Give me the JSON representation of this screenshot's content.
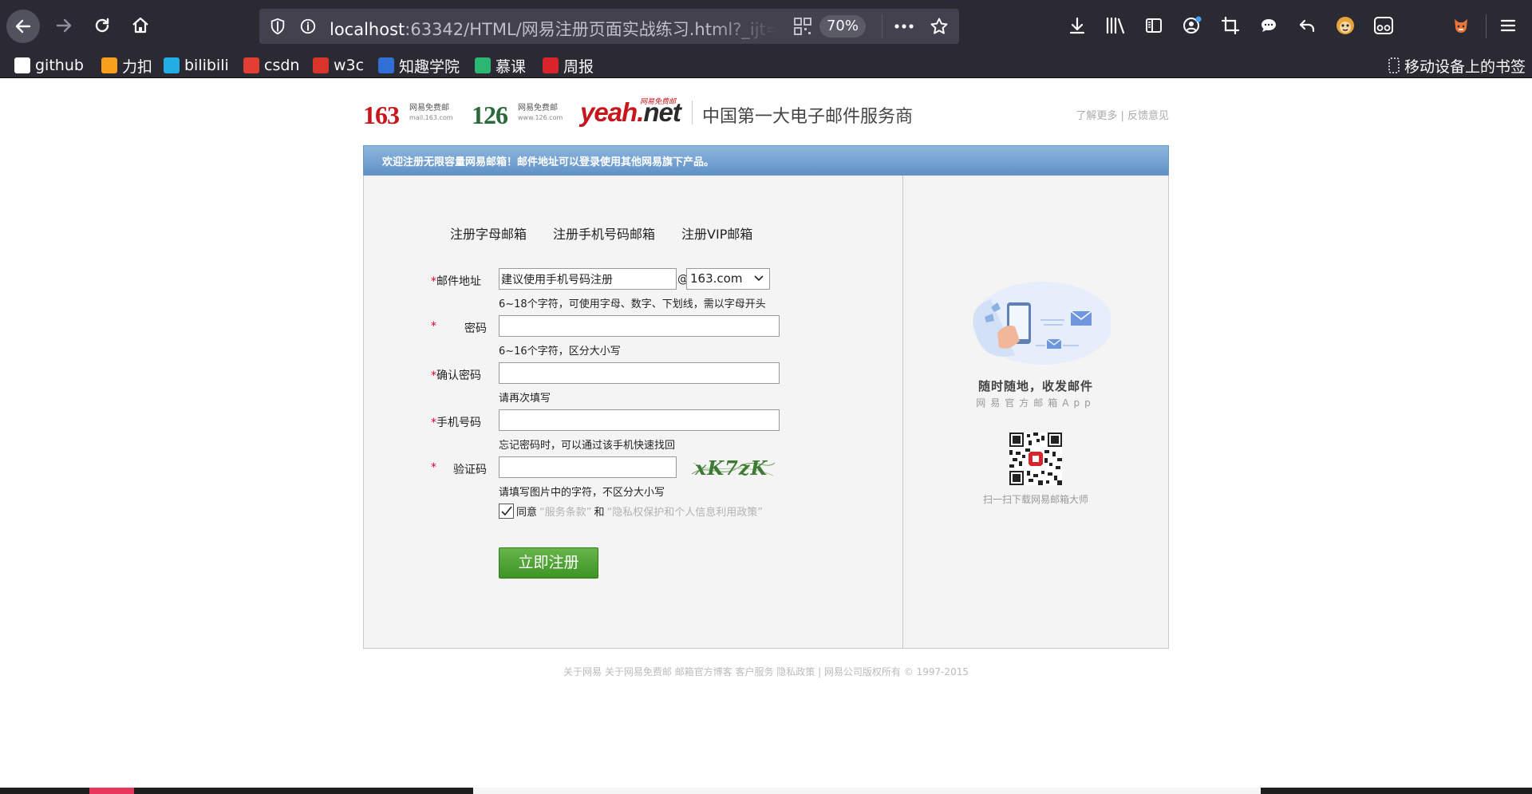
{
  "browser": {
    "url_host": "localhost",
    "url_path": ":63342/HTML/网易注册页面实战练习.html?_ijt=",
    "zoom": "70%",
    "bookmarks": [
      {
        "label": "github",
        "icon": "github-icon",
        "color": "#ffffff"
      },
      {
        "label": "力扣",
        "icon": "leetcode-icon",
        "color": "#f89f1b"
      },
      {
        "label": "bilibili",
        "icon": "bilibili-icon",
        "color": "#23ade5"
      },
      {
        "label": "csdn",
        "icon": "csdn-icon",
        "color": "#e33e33"
      },
      {
        "label": "w3c",
        "icon": "w3c-icon",
        "color": "#d9342b"
      },
      {
        "label": "知趣学院",
        "icon": "zhiqu-icon",
        "color": "#2f6fd6"
      },
      {
        "label": "慕课",
        "icon": "mooc-icon",
        "color": "#2bb673"
      },
      {
        "label": "周报",
        "icon": "netease-icon",
        "color": "#d8242a"
      }
    ],
    "mobile_bookmarks": "移动设备上的书签"
  },
  "header": {
    "logo_163": "163",
    "logo_163_sub": "网易免费邮",
    "logo_163_domain": "mail.163.com",
    "logo_126": "126",
    "logo_126_sub": "网易免费邮",
    "logo_126_domain": "www.126.com",
    "logo_yeah": "yeah.",
    "logo_yeah_net": "net",
    "logo_yeah_tag": "网易免费邮",
    "slogan": "中国第一大电子邮件服务商",
    "link_more": "了解更多",
    "link_sep": " | ",
    "link_feedback": "反馈意见"
  },
  "banner": "欢迎注册无限容量网易邮箱！邮件地址可以登录使用其他网易旗下产品。",
  "tabs": [
    "注册字母邮箱",
    "注册手机号码邮箱",
    "注册VIP邮箱"
  ],
  "form": {
    "email": {
      "star": "*",
      "label": "邮件地址",
      "value": "建议使用手机号码注册",
      "at": "@",
      "domain": "163.com",
      "hint": "6~18个字符，可使用字母、数字、下划线，需以字母开头"
    },
    "password": {
      "star": "*",
      "label": "密码",
      "hint": "6~16个字符，区分大小写"
    },
    "confirm": {
      "star": "*",
      "label": "确认密码",
      "hint": "请再次填写"
    },
    "phone": {
      "star": "*",
      "label": "手机号码",
      "hint": "忘记密码时，可以通过该手机快速找回"
    },
    "captcha": {
      "star": "*",
      "label": "验证码",
      "hint": "请填写图片中的字符，不区分大小写",
      "image_text": "xK7zK"
    },
    "agree": {
      "checked": true,
      "prefix": "同意",
      "terms": "“服务条款”",
      "and": "和",
      "privacy": "“隐私权保护和个人信息利用政策”"
    },
    "submit": "立即注册"
  },
  "app": {
    "title": "随时随地，收发邮件",
    "subtitle": "网易官方邮箱App",
    "qr_caption": "扫一扫下载网易邮箱大师"
  },
  "footer": "关于网易 关于网易免费邮 邮箱官方博客 客户服务 隐私政策 | 网易公司版权所有 © 1997-2015"
}
